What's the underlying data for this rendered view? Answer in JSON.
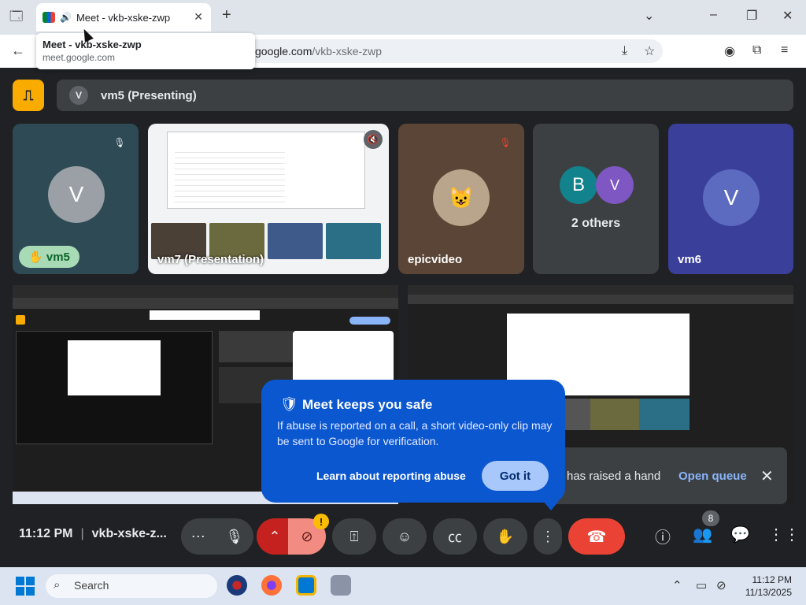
{
  "browser": {
    "tab_title": "Meet - vkb-xske-zwp",
    "tooltip_title": "Meet - vkb-xske-zwp",
    "tooltip_url": "meet.google.com",
    "address_host": "google.com",
    "address_path": "/vkb-xske-zwp"
  },
  "presenting_bar": {
    "avatar_letter": "V",
    "label": "vm5 (Presenting)"
  },
  "tiles": [
    {
      "name": "vm5",
      "letter": "V",
      "muted": true,
      "hand_raised": true
    },
    {
      "name": "vm7 (Presentation)",
      "type": "screen"
    },
    {
      "name": "epicvideo",
      "muted": true,
      "type": "video"
    },
    {
      "name": "2 others",
      "letters": [
        "B",
        "V"
      ]
    },
    {
      "name": "vm6",
      "letter": "V"
    }
  ],
  "callout": {
    "title": "Meet keeps you safe",
    "body": "If abuse is reported on a call, a short video-only clip may be sent to Google for verification.",
    "learn_link": "Learn about reporting abuse",
    "button": "Got it"
  },
  "toast": {
    "text": "has raised a hand",
    "action": "Open queue"
  },
  "controls": {
    "time": "11:12 PM",
    "meeting_code": "vkb-xske-z...",
    "warning_mark": "!",
    "people_count": "8"
  },
  "taskbar": {
    "search_placeholder": "Search",
    "clock_time": "11:12 PM",
    "clock_date": "11/13/2025"
  },
  "colors": {
    "accent_present": "#f9ab00",
    "callout_bg": "#0b57d0",
    "end_call": "#ea4335",
    "hand_badge": "#a8dab5"
  }
}
